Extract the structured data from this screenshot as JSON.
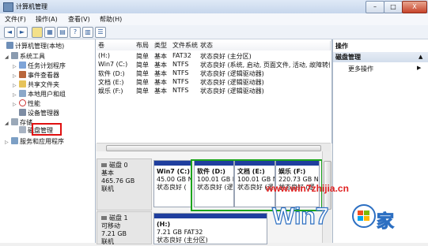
{
  "window": {
    "title": "计算机管理",
    "minimize": "–",
    "maximize": "□",
    "close": "X"
  },
  "menu": [
    "文件(F)",
    "操作(A)",
    "查看(V)",
    "帮助(H)"
  ],
  "tree": [
    {
      "label": "计算机管理(本地)",
      "depth": 0,
      "icon": "computer-icon",
      "expander": ""
    },
    {
      "label": "系统工具",
      "depth": 1,
      "icon": "tools-icon",
      "expander": "◢"
    },
    {
      "label": "任务计划程序",
      "depth": 2,
      "icon": "task-scheduler-icon",
      "expander": "▷"
    },
    {
      "label": "事件查看器",
      "depth": 2,
      "icon": "event-viewer-icon",
      "expander": "▷"
    },
    {
      "label": "共享文件夹",
      "depth": 2,
      "icon": "shared-folder-icon",
      "expander": "▷"
    },
    {
      "label": "本地用户和组",
      "depth": 2,
      "icon": "users-icon",
      "expander": "▷"
    },
    {
      "label": "性能",
      "depth": 2,
      "icon": "performance-icon",
      "expander": "▷"
    },
    {
      "label": "设备管理器",
      "depth": 2,
      "icon": "device-manager-icon",
      "expander": ""
    },
    {
      "label": "存储",
      "depth": 1,
      "icon": "storage-icon",
      "expander": "◢"
    },
    {
      "label": "磁盘管理",
      "depth": 2,
      "icon": "disk-management-icon",
      "expander": ""
    },
    {
      "label": "服务和应用程序",
      "depth": 1,
      "icon": "services-icon",
      "expander": "▷"
    }
  ],
  "volume_list": {
    "headers": [
      "卷",
      "布局",
      "类型",
      "文件系统",
      "状态"
    ],
    "rows": [
      [
        "(H:)",
        "简单",
        "基本",
        "FAT32",
        "状态良好 (主分区)"
      ],
      [
        "Win7 (C:)",
        "简单",
        "基本",
        "NTFS",
        "状态良好 (系统, 启动, 页面文件, 活动, 故障转储, 主分区)"
      ],
      [
        "软件 (D:)",
        "简单",
        "基本",
        "NTFS",
        "状态良好 (逻辑驱动器)"
      ],
      [
        "文档 (E:)",
        "简单",
        "基本",
        "NTFS",
        "状态良好 (逻辑驱动器)"
      ],
      [
        "娱乐 (F:)",
        "简单",
        "基本",
        "NTFS",
        "状态良好 (逻辑驱动器)"
      ]
    ]
  },
  "disks": [
    {
      "name": "磁盘 0",
      "type": "基本",
      "size": "465.76 GB",
      "status": "联机",
      "partitions": [
        {
          "name": "Win7 (C:)",
          "size": "45.00 GB N",
          "status": "状态良好 ("
        },
        {
          "name": "软件 (D:)",
          "size": "100.01 GB N",
          "status": "状态良好 (逻"
        },
        {
          "name": "文档 (E:)",
          "size": "100.01 GB N",
          "status": "状态良好 (逻"
        },
        {
          "name": "娱乐 (F:)",
          "size": "220.73 GB N",
          "status": "状态良好 (逻"
        }
      ]
    },
    {
      "name": "磁盘 1",
      "type": "可移动",
      "size": "7.21 GB",
      "status": "联机",
      "partitions": [
        {
          "name": "(H:)",
          "size": "7.21 GB FAT32",
          "status": "状态良好 (主分区)"
        }
      ]
    }
  ],
  "actions": {
    "header": "操作",
    "section": "磁盘管理",
    "more": "更多操作"
  },
  "watermark": {
    "url": "www.win7zhijia.cn",
    "logo_text": "Win7",
    "logo_suffix": "家"
  },
  "colors": {
    "partition_bar": "#1f3e9e",
    "highlight_red": "#e01010",
    "highlight_green": "#1ca51c"
  }
}
